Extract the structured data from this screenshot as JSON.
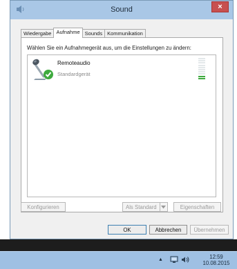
{
  "window": {
    "title": "Sound",
    "close_label": "×"
  },
  "tabs": [
    {
      "label": "Wiedergabe",
      "active": false
    },
    {
      "label": "Aufnahme",
      "active": true
    },
    {
      "label": "Sounds",
      "active": false
    },
    {
      "label": "Kommunikation",
      "active": false
    }
  ],
  "panel": {
    "instructions": "Wählen Sie ein Aufnahmegerät aus, um die Einstellungen zu ändern:",
    "devices": [
      {
        "name": "Remoteaudio",
        "status": "Standardgerät",
        "icon": "microphone-icon",
        "default_badge": "green-check-icon",
        "level_fraction": 0.2
      }
    ]
  },
  "buttons": {
    "configure": "Konfigurieren",
    "set_default": "Als Standard",
    "properties": "Eigenschaften",
    "ok": "OK",
    "cancel": "Abbrechen",
    "apply": "Übernehmen"
  },
  "taskbar": {
    "time": "12:59",
    "date": "10.08.2015",
    "tray_icons": [
      "show-hidden-icons-arrow",
      "network-icon",
      "volume-icon"
    ]
  },
  "colors": {
    "titlebar": "#a9c7e6",
    "close_button": "#c75050",
    "taskbar": "#9fc0e3",
    "level_on": "#3eaa3e",
    "check_badge": "#3eaa3e"
  }
}
